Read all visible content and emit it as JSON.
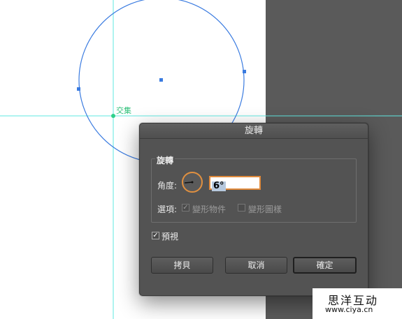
{
  "canvas": {
    "smart_guide_label": "交集",
    "colors": {
      "guide": "#5fe8e0",
      "path": "#3a7be0",
      "pasteboard": "#5a5a5a"
    }
  },
  "dialog": {
    "title": "旋轉",
    "group_title": "旋轉",
    "angle_label": "角度:",
    "angle_value": "6°",
    "options_label": "選項:",
    "option_objects": {
      "label": "變形物件",
      "checked": true,
      "enabled": false
    },
    "option_patterns": {
      "label": "變形圖樣",
      "checked": false,
      "enabled": false
    },
    "preview": {
      "label": "預視",
      "checked": true
    },
    "buttons": {
      "copy": "拷貝",
      "cancel": "取消",
      "ok": "確定"
    }
  },
  "watermark": {
    "name": "思洋互动",
    "url": "www.ciya.cn"
  }
}
